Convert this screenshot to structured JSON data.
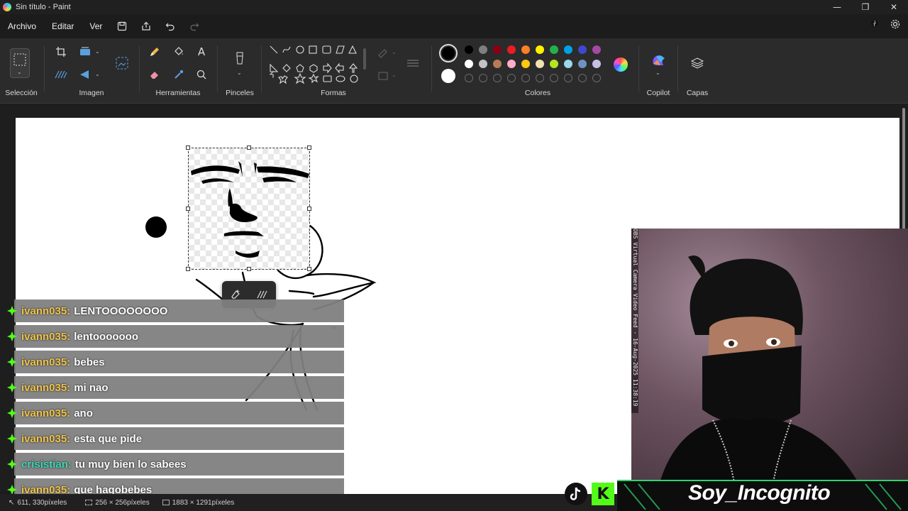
{
  "window": {
    "title": "Sin título - Paint",
    "min": "—",
    "max": "❐",
    "close": "✕"
  },
  "menu": {
    "items": [
      "Archivo",
      "Editar",
      "Ver"
    ]
  },
  "ribbon": {
    "groups": {
      "selection": "Selección",
      "image": "Imagen",
      "tools": "Herramientas",
      "brushes": "Pinceles",
      "shapes": "Formas",
      "colors": "Colores",
      "copilot": "Copilot",
      "layers": "Capas"
    },
    "palette_row1": [
      "#000000",
      "#7f7f7f",
      "#880015",
      "#ed1c24",
      "#ff7f27",
      "#fff200",
      "#22b14c",
      "#00a2e8",
      "#3f48cc",
      "#a349a4"
    ],
    "palette_row2": [
      "#ffffff",
      "#c3c3c3",
      "#b97a57",
      "#ffaec9",
      "#ffc90e",
      "#efe4b0",
      "#b5e61d",
      "#99d9ea",
      "#7092be",
      "#c8bfe7"
    ],
    "primary_color": "#000000",
    "secondary_color": "#ffffff"
  },
  "chat": [
    {
      "user": "ivann035:",
      "msg": "LENTOOOOOOOO",
      "color": "#f0c34a"
    },
    {
      "user": "ivann035:",
      "msg": "lentooooooo",
      "color": "#f0c34a"
    },
    {
      "user": "ivann035:",
      "msg": "bebes",
      "color": "#f0c34a"
    },
    {
      "user": "ivann035:",
      "msg": "mi nao",
      "color": "#f0c34a"
    },
    {
      "user": "ivann035:",
      "msg": "ano",
      "color": "#f0c34a"
    },
    {
      "user": "ivann035:",
      "msg": "esta que pide",
      "color": "#f0c34a"
    },
    {
      "user": "crisistian:",
      "msg": "tu muy bien lo sabees",
      "color": "#3fd8b8"
    },
    {
      "user": "ivann035:",
      "msg": "que hagobebes",
      "color": "#f0c34a"
    }
  ],
  "webcam": {
    "overlay_text": "OBS Virtual Camera Video Feed - 16-Aug-2025 11:38:19 PM",
    "streamer_name": "Soy_Incognito"
  },
  "status": {
    "cursor": "611, 330píxeles",
    "selection_size": "256 × 256píxeles",
    "canvas_size": "1883 × 1291píxeles"
  }
}
